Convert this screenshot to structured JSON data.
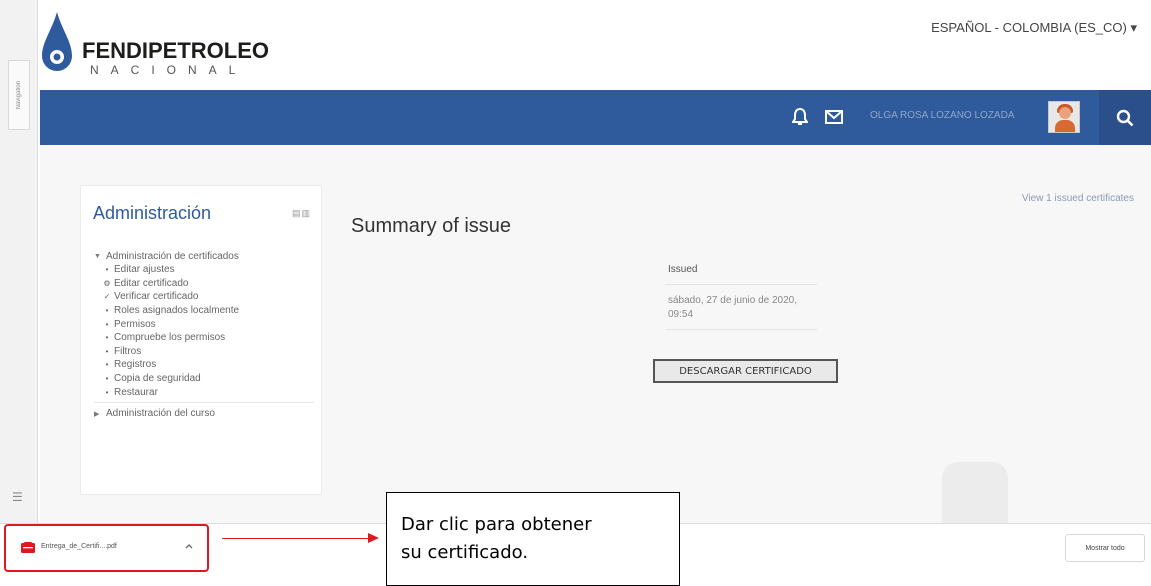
{
  "drawer": {
    "tab_label": "Navigation",
    "toggle_icon": "menu-icon"
  },
  "header": {
    "logo_name": "FENDIPETROLEO",
    "logo_sub": "NACIONAL",
    "language": "ESPAÑOL - COLOMBIA (ES_CO) ▾"
  },
  "navbar": {
    "user_name": "OLGA ROSA LOZANO LOZADA",
    "icons": [
      "bell-icon",
      "mail-icon",
      "search-icon"
    ],
    "accent": "#2f5b9c"
  },
  "admin": {
    "title": "Administración",
    "section_title": "Administración de certificados",
    "items": [
      {
        "icon": "•",
        "label": "Editar ajustes"
      },
      {
        "icon": "⚙",
        "label": "Editar certificado"
      },
      {
        "icon": "✓",
        "label": "Verificar certificado"
      },
      {
        "icon": "•",
        "label": "Roles asignados localmente"
      },
      {
        "icon": "•",
        "label": "Permisos"
      },
      {
        "icon": "•",
        "label": "Compruebe los permisos"
      },
      {
        "icon": "•",
        "label": "Filtros"
      },
      {
        "icon": "•",
        "label": "Registros"
      },
      {
        "icon": "•",
        "label": "Copia de seguridad"
      },
      {
        "icon": "•",
        "label": "Restaurar"
      }
    ],
    "course_section": "Administración del curso"
  },
  "main": {
    "title": "Summary of issue",
    "view_link": "View 1 issued certificates",
    "issued_label": "Issued",
    "issued_date": "sábado, 27 de junio de 2020, 09:54",
    "download_button": "DESCARGAR CERTIFICADO"
  },
  "download_bar": {
    "filename": "Entrega_de_Certifi....pdf",
    "show_all": "Mostrar todo"
  },
  "annotation": {
    "line1": "Dar clic para obtener",
    "line2": "su certificado.",
    "color": "#e0181e"
  }
}
